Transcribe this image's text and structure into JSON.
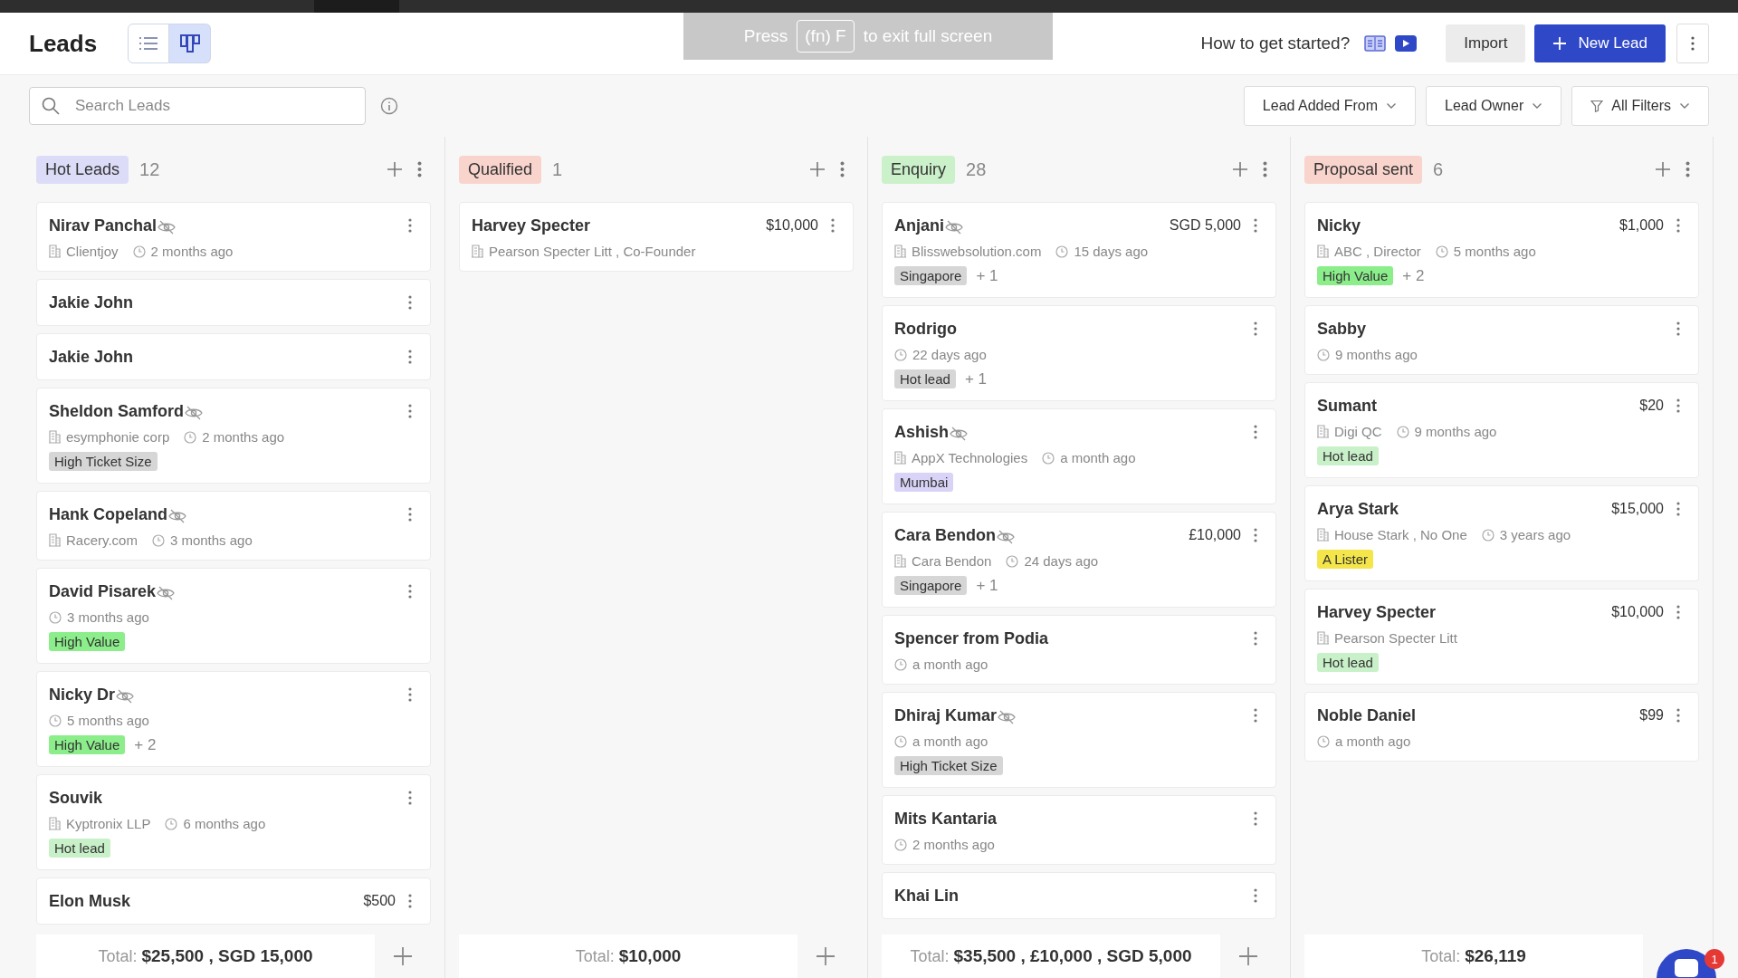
{
  "header": {
    "title": "Leads",
    "views": [
      {
        "kind": "list",
        "selected": false
      },
      {
        "kind": "board",
        "selected": true
      }
    ],
    "help_text": "How to get started?",
    "import_button": "Import",
    "new_button": "New Lead"
  },
  "fullscreen_hint": {
    "before": "Press",
    "key": "(fn) F",
    "after": "to exit full screen"
  },
  "search": {
    "placeholder": "Search Leads"
  },
  "filters": [
    {
      "label": "Lead Added From",
      "kind": "dropdown"
    },
    {
      "label": "Lead Owner",
      "kind": "dropdown"
    },
    {
      "label": "All Filters",
      "kind": "filter"
    }
  ],
  "columns": [
    {
      "title": "Hot Leads",
      "count": "12",
      "color": "#dcdcf8",
      "total": "Total: **$25,500 , SGD 15,000**",
      "add_button": true,
      "cards": [
        {
          "name": "Nirav Panchal",
          "masked": true,
          "company": "Clientjoy",
          "time": "2 months ago"
        },
        {
          "name": "Jakie John",
          "masked": false
        },
        {
          "name": "Jakie John",
          "masked": false
        },
        {
          "name": "Sheldon Samford",
          "masked": true,
          "company": "esymphonie corp",
          "time": "2 months ago",
          "tags": [
            {
              "label": "High Ticket Size",
              "color": "#d6d6d6"
            }
          ]
        },
        {
          "name": "Hank Copeland",
          "masked": true,
          "company": "Racery.com",
          "time": "3 months ago"
        },
        {
          "name": "David Pisarek",
          "masked": true,
          "time": "3 months ago",
          "tags": [
            {
              "label": "High Value",
              "color": "#8bee8b"
            }
          ]
        },
        {
          "name": "Nicky Dr",
          "masked": true,
          "time": "5 months ago",
          "tags": [
            {
              "label": "High Value",
              "color": "#8bee8b"
            }
          ],
          "more": "+ 2"
        },
        {
          "name": "Souvik",
          "masked": false,
          "company": "Kyptronix LLP",
          "time": "6 months ago",
          "tags": [
            {
              "label": "Hot lead",
              "color": "#c9f1c9"
            }
          ]
        },
        {
          "name": "Elon Musk",
          "masked": false,
          "amount": "$500"
        }
      ]
    },
    {
      "title": "Qualified",
      "count": "1",
      "color": "#f9d4cd",
      "total": "Total: **$10,000**",
      "add_button": true,
      "cards": [
        {
          "name": "Harvey Specter",
          "masked": false,
          "amount": "$10,000",
          "company": "Pearson Specter Litt , Co-Founder"
        }
      ]
    },
    {
      "title": "Enquiry",
      "count": "28",
      "color": "#caf1ca",
      "total": "Total: **$35,500 , £10,000 , SGD 5,000**",
      "add_button": true,
      "cards": [
        {
          "name": "Anjani",
          "masked": true,
          "amount": "SGD 5,000",
          "company": "Blisswebsolution.com",
          "time": "15 days ago",
          "tags": [
            {
              "label": "Singapore",
              "color": "#d6d6d6"
            }
          ],
          "more": "+ 1"
        },
        {
          "name": "Rodrigo",
          "masked": false,
          "time": "22 days ago",
          "tags": [
            {
              "label": "Hot lead",
              "color": "#d6d6d6"
            }
          ],
          "more": "+ 1"
        },
        {
          "name": "Ashish",
          "masked": true,
          "company": "AppX Technologies",
          "time": "a month ago",
          "tags": [
            {
              "label": "Mumbai",
              "color": "#d8d3f7"
            }
          ]
        },
        {
          "name": "Cara Bendon",
          "masked": true,
          "amount": "£10,000",
          "company": "Cara Bendon",
          "time": "24 days ago",
          "tags": [
            {
              "label": "Singapore",
              "color": "#d6d6d6"
            }
          ],
          "more": "+ 1"
        },
        {
          "name": "Spencer from Podia",
          "masked": false,
          "time": "a month ago"
        },
        {
          "name": "Dhiraj Kumar",
          "masked": true,
          "time": "a month ago",
          "tags": [
            {
              "label": "High Ticket Size",
              "color": "#d6d6d6"
            }
          ]
        },
        {
          "name": "Mits Kantaria",
          "masked": false,
          "time": "2 months ago"
        },
        {
          "name": "Khai Lin",
          "masked": false
        }
      ]
    },
    {
      "title": "Proposal sent",
      "count": "6",
      "color": "#f9d4cd",
      "total": "Total: **$26,119**",
      "add_button": false,
      "cards": [
        {
          "name": "Nicky",
          "masked": false,
          "amount": "$1,000",
          "company": "ABC , Director",
          "time": "5 months ago",
          "tags": [
            {
              "label": "High Value",
              "color": "#8bee8b"
            }
          ],
          "more": "+ 2"
        },
        {
          "name": "Sabby",
          "masked": false,
          "time": "9 months ago"
        },
        {
          "name": "Sumant",
          "masked": false,
          "amount": "$20",
          "company": "Digi QC",
          "time": "9 months ago",
          "tags": [
            {
              "label": "Hot lead",
              "color": "#c9f1c9"
            }
          ]
        },
        {
          "name": "Arya Stark",
          "masked": false,
          "amount": "$15,000",
          "company": "House Stark , No One",
          "time": "3 years ago",
          "tags": [
            {
              "label": "A Lister",
              "color": "#f4e64a"
            }
          ]
        },
        {
          "name": "Harvey Specter",
          "masked": false,
          "amount": "$10,000",
          "company": "Pearson Specter Litt",
          "tags": [
            {
              "label": "Hot lead",
              "color": "#c9f1c9"
            }
          ]
        },
        {
          "name": "Noble Daniel",
          "masked": false,
          "amount": "$99",
          "time": "a month ago"
        }
      ]
    }
  ],
  "chat": {
    "badge": "1"
  }
}
